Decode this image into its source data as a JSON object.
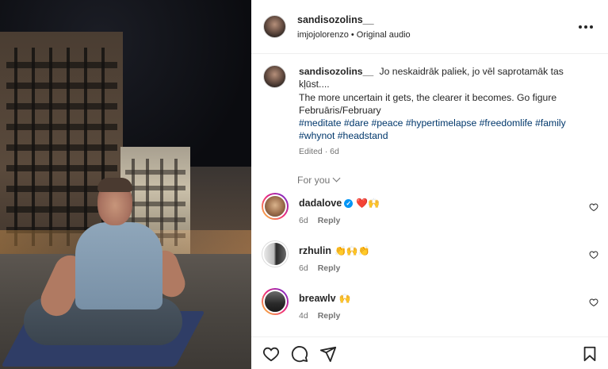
{
  "media": {
    "alt_description": ""
  },
  "header": {
    "username": "sandisozolins__",
    "subtitle": "imjojolorenzo • Original audio",
    "more_icon": "more-horizontal-icon"
  },
  "caption": {
    "username": "sandisozolins__",
    "line1": "Jo neskaidrāk paliek, jo vēl saprotamāk tas kļūst....",
    "line2": "The more uncertain it gets, the clearer it becomes. Go figure",
    "line3": "Februāris/February",
    "hashtags": "#meditate #dare #peace #hypertimelapse #freedomlife #family #whynot #headstand",
    "meta": "Edited · 6d"
  },
  "for_you": {
    "label": "For you"
  },
  "comments": [
    {
      "username": "dadalove",
      "verified": true,
      "text": "❤️🙌",
      "time": "6d",
      "reply": "Reply"
    },
    {
      "username": "rzhulin",
      "verified": false,
      "text": "👏🙌👏",
      "time": "6d",
      "reply": "Reply"
    },
    {
      "username": "breawlv",
      "verified": false,
      "text": "🙌",
      "time": "4d",
      "reply": "Reply"
    }
  ],
  "actions": {
    "like": "heart-icon",
    "comment": "comment-icon",
    "share": "send-icon",
    "save": "bookmark-icon"
  },
  "colors": {
    "link": "#00376b",
    "muted": "#737373",
    "verified": "#0095f6"
  }
}
